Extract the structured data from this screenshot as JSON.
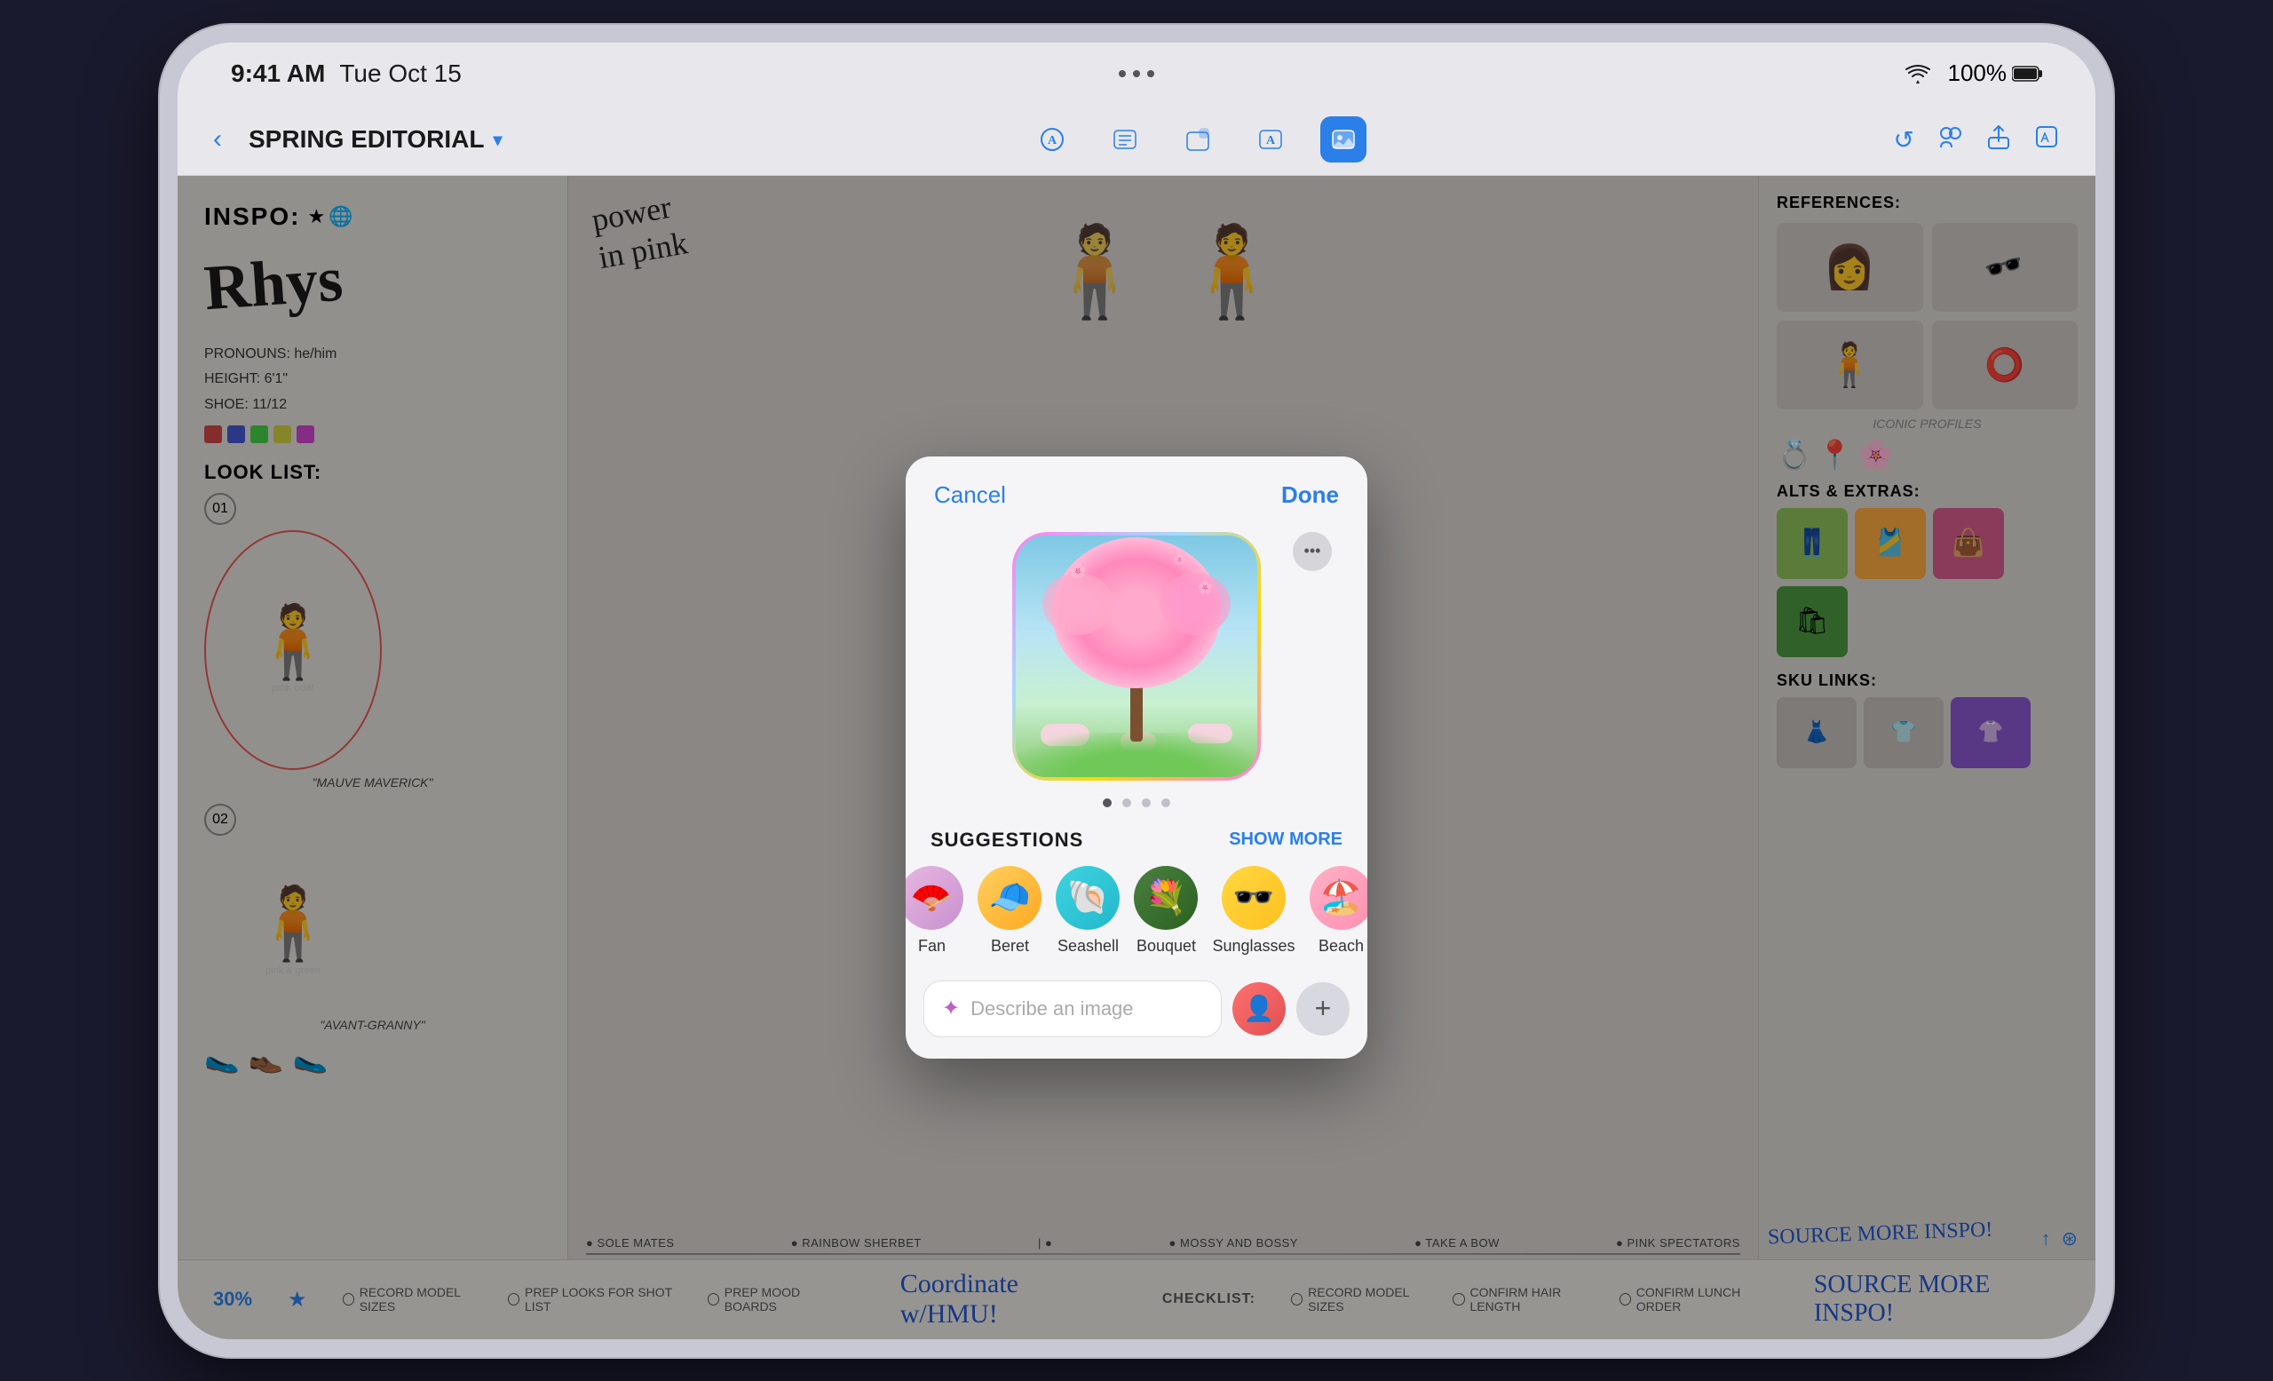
{
  "device": {
    "status_bar": {
      "time": "9:41 AM",
      "date": "Tue Oct 15",
      "battery_percent": "100%",
      "wifi": "WiFi"
    }
  },
  "toolbar": {
    "back_label": "‹",
    "title": "SPRING EDITORIAL",
    "chevron": "▾",
    "dots": "•••",
    "tools": [
      {
        "name": "pen-tool",
        "icon": "A",
        "active": false
      },
      {
        "name": "text-tool",
        "icon": "☰",
        "active": false
      },
      {
        "name": "shape-tool",
        "icon": "⬡",
        "active": false
      },
      {
        "name": "type-tool",
        "icon": "A",
        "active": false
      },
      {
        "name": "image-tool",
        "icon": "⬜",
        "active": true
      }
    ],
    "right_icons": [
      {
        "name": "undo-icon",
        "icon": "↺"
      },
      {
        "name": "person-icon",
        "icon": "👤"
      },
      {
        "name": "share-icon",
        "icon": "↑"
      },
      {
        "name": "edit-icon",
        "icon": "✏"
      }
    ]
  },
  "board": {
    "left": {
      "inspo_label": "INSPO:",
      "rhys_text": "Rhys",
      "info": {
        "pronouns": "PRONOUNS: he/him",
        "height": "HEIGHT: 6'1\"",
        "shoe": "SHOE: 11/12"
      },
      "color_swatches": [
        "#CC4444",
        "#4444CC",
        "#44CC44",
        "#CCCC44",
        "#CC44CC"
      ],
      "look_list_label": "LOOK LIST:",
      "model1_label": "\"MAUVE MAVERICK\"",
      "model2_label": "\"AVANT-GRANNY\""
    },
    "center": {
      "notes_label": "Coordinate w/HMU!",
      "checklist_label": "CHECKLIST:",
      "timeline": [
        "SOLE MATES",
        "RAINBOW SHERBET",
        "MOSSY AND BOSSY",
        "TAKE A BOW",
        "PINK SPECTATORS"
      ]
    },
    "right": {
      "references_label": "REFERENCES:",
      "alts_label": "ALTS & EXTRAS:",
      "sku_label": "SKU LINKS:",
      "source_notes": "SOURCE MORE INSPO!"
    }
  },
  "modal": {
    "cancel_label": "Cancel",
    "done_label": "Done",
    "more_icon": "•••",
    "image_alt": "Cherry blossom tree illustration",
    "page_dots": [
      true,
      false,
      false,
      false
    ],
    "suggestions_label": "SUGGESTIONS",
    "show_more_label": "SHOW MORE",
    "suggestions": [
      {
        "name": "fan",
        "emoji": "🪭",
        "label": "Fan",
        "bg_class": "fan-bg"
      },
      {
        "name": "beret",
        "emoji": "🧢",
        "label": "Beret",
        "bg_class": "beret-bg"
      },
      {
        "name": "seashell",
        "emoji": "🐚",
        "label": "Seashell",
        "bg_class": "seashell-bg"
      },
      {
        "name": "bouquet",
        "emoji": "💐",
        "label": "Bouquet",
        "bg_class": "bouquet-bg"
      },
      {
        "name": "sunglasses",
        "emoji": "🕶",
        "label": "Sunglasses",
        "bg_class": "sunglasses-bg"
      },
      {
        "name": "beach",
        "emoji": "🏖",
        "label": "Beach",
        "bg_class": "beach-bg"
      }
    ],
    "input_placeholder": "Describe an image",
    "input_icon": "✦",
    "person_btn_icon": "👤",
    "plus_btn_icon": "+"
  },
  "bottom_bar": {
    "zoom": "30%",
    "notes": [
      "RECORD MODEL SIZES",
      "PREP LOOKS FOR SHOT LIST",
      "PREP MOOD BOARDS"
    ],
    "checklist": [
      "RECORD MODEL SIZES",
      "CONFIRM HAIR LENGTH",
      "CONFIRM LUNCH ORDER"
    ]
  }
}
